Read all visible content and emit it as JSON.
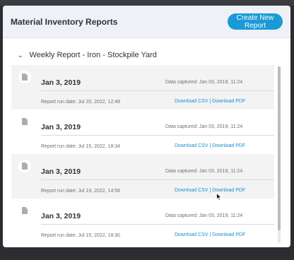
{
  "modal": {
    "title": "Material Inventory Reports",
    "create_button": "Create New Report"
  },
  "group": {
    "label": "Weekly Report - Iron - Stockpile Yard",
    "expanded": true
  },
  "reports": [
    {
      "date": "Jan 3, 2019",
      "captured": "Data captured: Jan 03, 2019, 11:24",
      "run_date": "Report run date: Jul 20, 2022, 12:48",
      "csv": "Download CSV",
      "sep": " | ",
      "pdf": "Download PDF"
    },
    {
      "date": "Jan 3, 2019",
      "captured": "Data captured: Jan 03, 2019, 11:24",
      "run_date": "Report run date: Jul 15, 2022, 18:34",
      "csv": "Download CSV",
      "sep": " | ",
      "pdf": "Download PDF"
    },
    {
      "date": "Jan 3, 2019",
      "captured": "Data captured: Jan 03, 2019, 11:24",
      "run_date": "Report run date: Jul 19, 2022, 14:56",
      "csv": "Download CSV",
      "sep": " | ",
      "pdf": "Download PDF"
    },
    {
      "date": "Jan 3, 2019",
      "captured": "Data captured: Jan 03, 2019, 11:24",
      "run_date": "Report run date: Jul 15, 2022, 18:30",
      "csv": "Download CSV",
      "sep": " | ",
      "pdf": "Download PDF"
    }
  ],
  "colors": {
    "accent": "#1a9ad6",
    "link": "#1a8fd1",
    "header_bg": "#eef1f5"
  },
  "icons": {
    "report": "document-icon",
    "group_toggle": "chevron-down-icon"
  }
}
